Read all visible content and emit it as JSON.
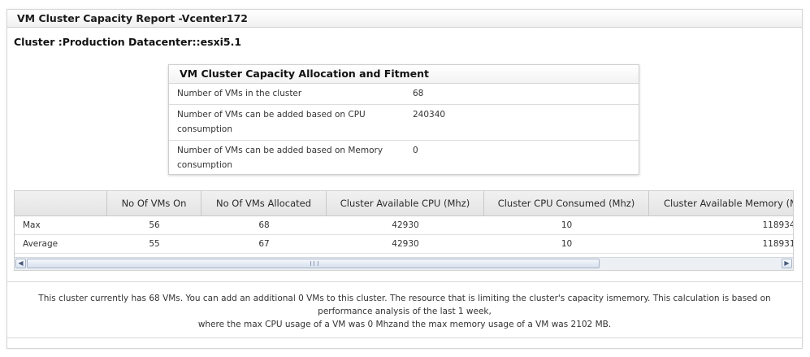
{
  "report": {
    "title": "VM Cluster Capacity Report -Vcenter172",
    "cluster_label": "Cluster :Production Datacenter::esxi5.1"
  },
  "fitment": {
    "title": "VM Cluster Capacity Allocation and Fitment",
    "rows": [
      {
        "label": "Number of VMs in the cluster",
        "value": "68"
      },
      {
        "label": "Number of VMs can be added based on CPU consumption",
        "value": "240340"
      },
      {
        "label": "Number of VMs can be added based on Memory consumption",
        "value": "0"
      }
    ]
  },
  "grid": {
    "columns": [
      "",
      "No Of VMs On",
      "No Of VMs Allocated",
      "Cluster Available CPU (Mhz)",
      "Cluster CPU Consumed (Mhz)",
      "Cluster Available Memory (M"
    ],
    "rows": [
      [
        "Max",
        "56",
        "68",
        "42930",
        "10",
        "118934"
      ],
      [
        "Average",
        "55",
        "67",
        "42930",
        "10",
        "118931"
      ]
    ],
    "scroll_left_icon": "triangle-left",
    "scroll_right_icon": "triangle-right"
  },
  "summary": {
    "line1": "This cluster currently has 68 VMs. You can add an additional 0 VMs to this cluster. The resource that is limiting the cluster's capacity ismemory. This calculation is based on",
    "line2": "performance analysis of the last 1 week,",
    "line3": "where the max CPU usage of a VM was 0 Mhzand the max memory usage of a VM was 2102 MB."
  }
}
